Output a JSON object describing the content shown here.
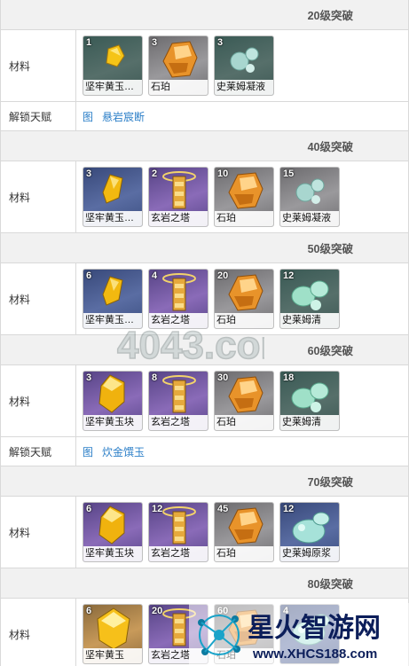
{
  "sections": [
    {
      "title": "20级突破",
      "materials_label": "材料",
      "items": [
        {
          "qty": "1",
          "name": "坚牢黄玉…",
          "icon": "gem-shard-icon",
          "bg": "green"
        },
        {
          "qty": "3",
          "name": "石珀",
          "icon": "amber-stone-icon",
          "bg": "white"
        },
        {
          "qty": "3",
          "name": "史莱姆凝液",
          "icon": "slime-condensate-icon",
          "bg": "green"
        }
      ],
      "talent": {
        "label": "解锁天赋",
        "link": "图",
        "name": "悬岩宸断"
      }
    },
    {
      "title": "40级突破",
      "materials_label": "材料",
      "items": [
        {
          "qty": "3",
          "name": "坚牢黄玉…",
          "icon": "gem-fragment-icon",
          "bg": "blue"
        },
        {
          "qty": "2",
          "name": "玄岩之塔",
          "icon": "basalt-tower-icon",
          "bg": "purple"
        },
        {
          "qty": "10",
          "name": "石珀",
          "icon": "amber-stone-icon",
          "bg": "white"
        },
        {
          "qty": "15",
          "name": "史莱姆凝液",
          "icon": "slime-condensate-icon",
          "bg": "white"
        }
      ]
    },
    {
      "title": "50级突破",
      "materials_label": "材料",
      "items": [
        {
          "qty": "6",
          "name": "坚牢黄玉…",
          "icon": "gem-fragment-icon",
          "bg": "blue"
        },
        {
          "qty": "4",
          "name": "玄岩之塔",
          "icon": "basalt-tower-icon",
          "bg": "purple"
        },
        {
          "qty": "20",
          "name": "石珀",
          "icon": "amber-stone-icon",
          "bg": "white"
        },
        {
          "qty": "12",
          "name": "史莱姆清",
          "icon": "slime-secretion-icon",
          "bg": "green"
        }
      ]
    },
    {
      "title": "60级突破",
      "materials_label": "材料",
      "items": [
        {
          "qty": "3",
          "name": "坚牢黄玉块",
          "icon": "gem-chunk-icon",
          "bg": "purple"
        },
        {
          "qty": "8",
          "name": "玄岩之塔",
          "icon": "basalt-tower-icon",
          "bg": "purple"
        },
        {
          "qty": "30",
          "name": "石珀",
          "icon": "amber-stone-icon",
          "bg": "white"
        },
        {
          "qty": "18",
          "name": "史莱姆清",
          "icon": "slime-secretion-icon",
          "bg": "green"
        }
      ],
      "talent": {
        "label": "解锁天赋",
        "link": "图",
        "name": "炊金馔玉"
      }
    },
    {
      "title": "70级突破",
      "materials_label": "材料",
      "items": [
        {
          "qty": "6",
          "name": "坚牢黄玉块",
          "icon": "gem-chunk-icon",
          "bg": "purple"
        },
        {
          "qty": "12",
          "name": "玄岩之塔",
          "icon": "basalt-tower-icon",
          "bg": "purple"
        },
        {
          "qty": "45",
          "name": "石珀",
          "icon": "amber-stone-icon",
          "bg": "white"
        },
        {
          "qty": "12",
          "name": "史莱姆原浆",
          "icon": "slime-concentrate-icon",
          "bg": "blue"
        }
      ]
    },
    {
      "title": "80级突破",
      "materials_label": "材料",
      "items": [
        {
          "qty": "6",
          "name": "坚牢黄玉",
          "icon": "gem-icon",
          "bg": "gold"
        },
        {
          "qty": "20",
          "name": "玄岩之塔",
          "icon": "basalt-tower-icon",
          "bg": "purple"
        },
        {
          "qty": "60",
          "name": "石珀",
          "icon": "amber-stone-icon",
          "bg": "white"
        },
        {
          "qty": "4",
          "name": "",
          "icon": "slime-concentrate-icon",
          "bg": "blue"
        }
      ]
    }
  ],
  "watermarks": {
    "top": "4043.com",
    "bottom_title": "星火智游网",
    "bottom_url": "www.XHCS188.com"
  },
  "colors": {
    "header_bg": "#f1f1f1",
    "border": "#d9d9d9",
    "link": "#2c7fc8"
  }
}
